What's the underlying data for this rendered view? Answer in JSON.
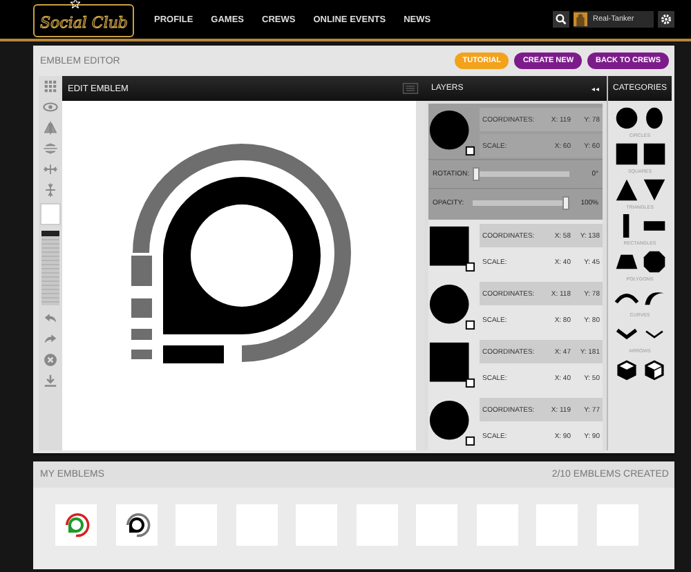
{
  "header": {
    "logo": "Social Club",
    "nav": [
      "PROFILE",
      "GAMES",
      "CREWS",
      "ONLINE EVENTS",
      "NEWS"
    ],
    "user": "Real-Tanker"
  },
  "editor": {
    "title": "EMBLEM EDITOR",
    "buttons": [
      {
        "label": "TUTORIAL",
        "kind": "orange"
      },
      {
        "label": "CREATE NEW",
        "kind": "purple"
      },
      {
        "label": "BACK TO CREWS",
        "kind": "purple"
      }
    ],
    "canvas_title": "EDIT EMBLEM",
    "tools": [
      {
        "kind": "grid"
      },
      {
        "kind": "eye"
      },
      {
        "kind": "flip-v"
      },
      {
        "kind": "flip-h"
      },
      {
        "kind": "align-h"
      },
      {
        "kind": "align-v"
      },
      {
        "kind": "swatch"
      },
      {
        "kind": "palette"
      },
      {
        "kind": "undo"
      },
      {
        "kind": "redo"
      },
      {
        "kind": "delete"
      },
      {
        "kind": "download"
      }
    ],
    "layers_title": "LAYERS",
    "collapse": "◂◂",
    "layers": [
      {
        "kind": "circle",
        "selected": true,
        "coord_label": "COORDINATES:",
        "x": "X: 119",
        "y": "Y: 78",
        "scale_label": "SCALE:",
        "sx": "X: 60",
        "sy": "Y: 60"
      },
      {
        "kind": "square",
        "selected": false,
        "coord_label": "COORDINATES:",
        "x": "X: 58",
        "y": "Y: 138",
        "scale_label": "SCALE:",
        "sx": "X: 40",
        "sy": "Y: 45"
      },
      {
        "kind": "circle",
        "selected": false,
        "coord_label": "COORDINATES:",
        "x": "X: 118",
        "y": "Y: 78",
        "scale_label": "SCALE:",
        "sx": "X: 80",
        "sy": "Y: 80"
      },
      {
        "kind": "square",
        "selected": false,
        "coord_label": "COORDINATES:",
        "x": "X: 47",
        "y": "Y: 181",
        "scale_label": "SCALE:",
        "sx": "X: 40",
        "sy": "Y: 50"
      },
      {
        "kind": "circle",
        "selected": false,
        "coord_label": "COORDINATES:",
        "x": "X: 119",
        "y": "Y: 77",
        "scale_label": "SCALE:",
        "sx": "X: 90",
        "sy": "Y: 90"
      }
    ],
    "sliders": [
      {
        "label": "ROTATION:",
        "level": 0,
        "reading": "0°"
      },
      {
        "label": "OPACITY:",
        "level": 1,
        "reading": "100%"
      }
    ],
    "categories_title": "CATEGORIES",
    "categories": [
      {
        "label": "CIRCLES",
        "shapes": [
          {
            "kind": "circle"
          },
          {
            "kind": "ellipse"
          }
        ]
      },
      {
        "label": "SQUARES",
        "shapes": [
          {
            "kind": "square"
          },
          {
            "kind": "square"
          }
        ]
      },
      {
        "label": "TRIANGLES",
        "shapes": [
          {
            "kind": "tri-up"
          },
          {
            "kind": "tri-down"
          }
        ]
      },
      {
        "label": "RECTANGLES",
        "shapes": [
          {
            "kind": "bar-v"
          },
          {
            "kind": "bar-h"
          }
        ]
      },
      {
        "label": "POLYGONS",
        "shapes": [
          {
            "kind": "trapezoid"
          },
          {
            "kind": "octagon"
          }
        ]
      },
      {
        "label": "CURVES",
        "shapes": [
          {
            "kind": "arc"
          },
          {
            "kind": "swoosh"
          }
        ]
      },
      {
        "label": "ARROWS",
        "shapes": [
          {
            "kind": "chevron"
          },
          {
            "kind": "chevron-thin"
          }
        ]
      },
      {
        "shapes": [
          {
            "kind": "cube"
          },
          {
            "kind": "cube-open"
          }
        ]
      }
    ]
  },
  "my_emblems": {
    "title": "MY EMBLEMS",
    "count": "2/10 EMBLEMS CREATED",
    "slots": [
      {
        "kind": "color"
      },
      {
        "kind": "mono"
      },
      {
        "kind": "empty"
      },
      {
        "kind": "empty"
      },
      {
        "kind": "empty"
      },
      {
        "kind": "empty"
      },
      {
        "kind": "empty"
      },
      {
        "kind": "empty"
      },
      {
        "kind": "empty"
      },
      {
        "kind": "empty"
      }
    ]
  }
}
